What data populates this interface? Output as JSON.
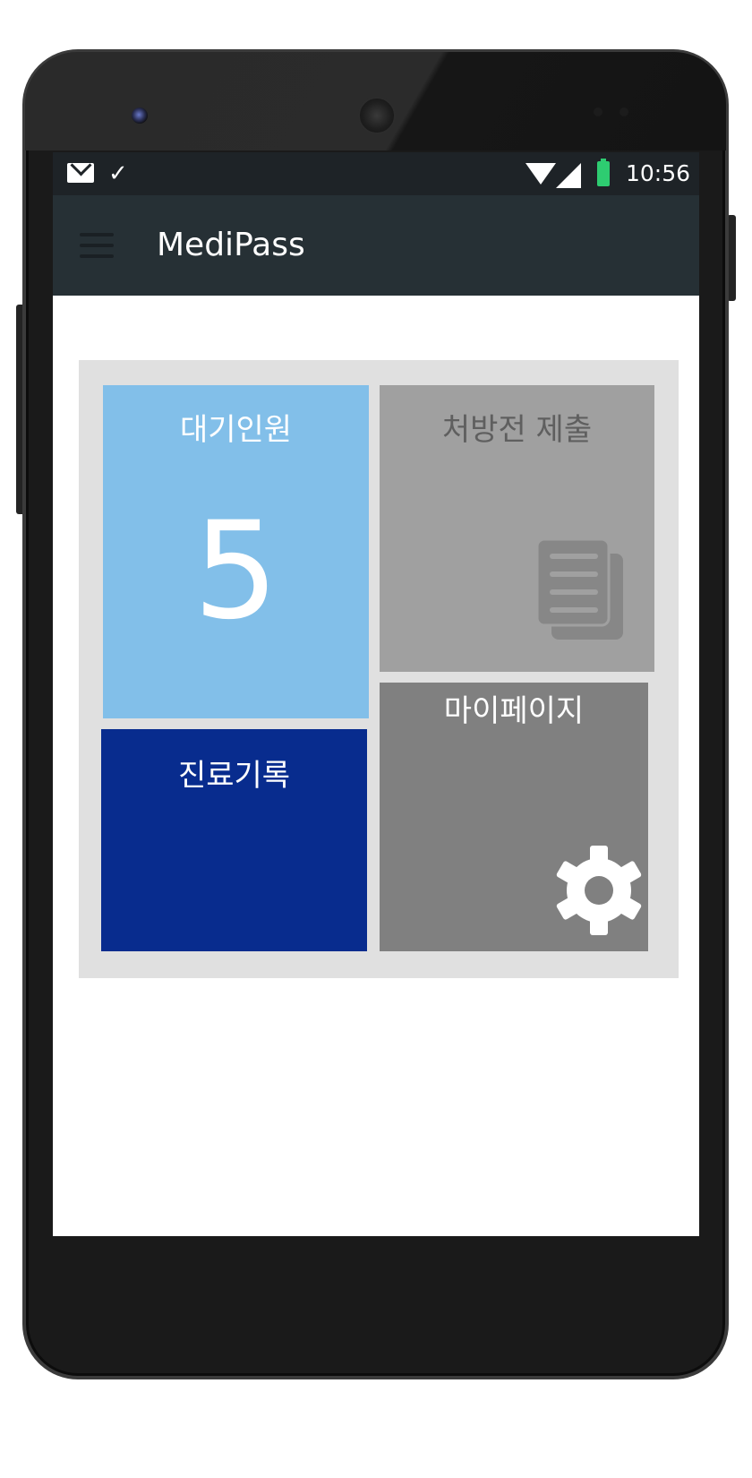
{
  "status_bar": {
    "time": "10:56",
    "icons": [
      "mail-icon",
      "check-icon",
      "wifi-icon",
      "signal-icon",
      "battery-icon"
    ],
    "check_glyph": "✓"
  },
  "app_bar": {
    "title": "MediPass",
    "menu_icon": "hamburger-menu-icon"
  },
  "dashboard": {
    "tiles": [
      {
        "id": "waiting",
        "label": "대기인원",
        "value": "5",
        "color": "#82bfe9"
      },
      {
        "id": "prescription",
        "label": "처방전 제출",
        "icon": "document-icon",
        "color": "#a0a0a0"
      },
      {
        "id": "records",
        "label": "진료기록",
        "color": "#082c8e"
      },
      {
        "id": "mypage",
        "label": "마이페이지",
        "icon": "gear-icon",
        "color": "#808080"
      }
    ]
  },
  "colors": {
    "status_bar": "#1e2327",
    "app_bar": "#263035",
    "grid_background": "#e0e0e0",
    "battery": "#2ecc71"
  }
}
